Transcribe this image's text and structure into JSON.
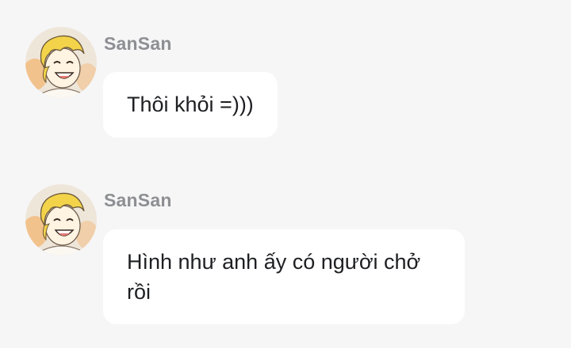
{
  "chat": {
    "messages": [
      {
        "sender": "SanSan",
        "text": "Thôi khỏi =)))",
        "avatar_icon": "user-avatar-blonde-cartoon"
      },
      {
        "sender": "SanSan",
        "text": "Hình như anh ấy có người chở rồi",
        "avatar_icon": "user-avatar-blonde-cartoon"
      }
    ]
  },
  "colors": {
    "background": "#f6f6f7",
    "bubble": "#ffffff",
    "sender_name": "#8e8f93",
    "message_text": "#1e1f22"
  }
}
